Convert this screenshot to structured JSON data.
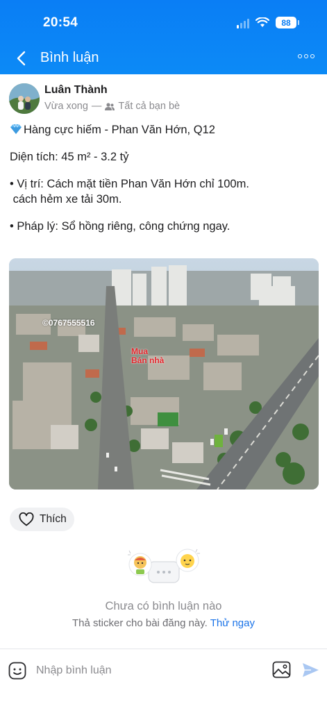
{
  "status_bar": {
    "time": "20:54",
    "battery": "88"
  },
  "nav": {
    "title": "Bình luận",
    "back_icon": "chevron-left-icon",
    "more_icon": "ellipsis-icon"
  },
  "post": {
    "author": "Luân Thành",
    "time": "Vừa xong",
    "audience": "Tất cả bạn bè",
    "lines": [
      "Hàng cực hiếm - Phan Văn Hớn, Q12",
      "Diện tích: 45 m²  - 3.2 tỷ",
      "• Vị trí: Cách mặt tiền Phan Văn Hớn chỉ 100m.",
      " cách hẻm xe tải 30m.",
      "• Pháp lý: Sổ hồng riêng, công chứng ngay."
    ],
    "image_watermark": "©0767555516",
    "image_logo": [
      "Mua",
      "Bán nhà"
    ]
  },
  "like": {
    "label": "Thích"
  },
  "empty_state": {
    "title": "Chưa có bình luận nào",
    "subtitle": "Thả sticker cho bài đăng này.",
    "link": "Thử ngay"
  },
  "composer": {
    "placeholder": "Nhập bình luận"
  },
  "colors": {
    "header_blue": "#0a7ef5",
    "link_blue": "#1a73e8"
  }
}
